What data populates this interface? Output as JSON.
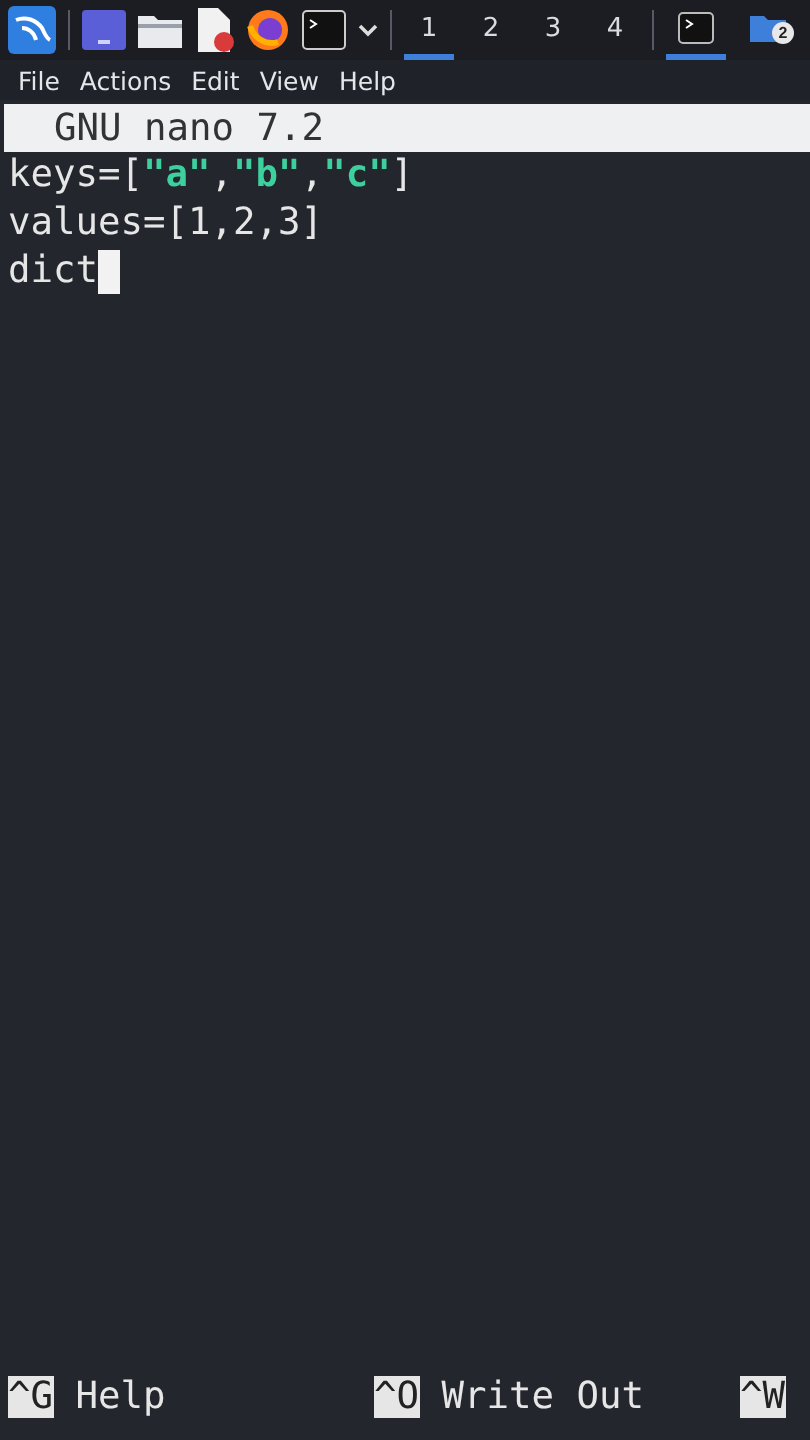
{
  "taskbar": {
    "launchers": [
      {
        "kind": "kali"
      },
      {
        "kind": "desktop"
      },
      {
        "kind": "folder"
      },
      {
        "kind": "editor"
      },
      {
        "kind": "firefox"
      },
      {
        "kind": "terminal"
      },
      {
        "kind": "chevron"
      }
    ],
    "workspaces": [
      {
        "label": "1",
        "selected": true
      },
      {
        "label": "2",
        "selected": false
      },
      {
        "label": "3",
        "selected": false
      },
      {
        "label": "4",
        "selected": false
      }
    ],
    "tasks": [
      {
        "kind": "terminal",
        "selected": true
      },
      {
        "kind": "folder",
        "selected": false,
        "badge": "2"
      }
    ]
  },
  "menu": [
    "File",
    "Actions",
    "Edit",
    "View",
    "Help"
  ],
  "nano": {
    "title": "GNU nano 7.2",
    "lines": [
      {
        "segments": [
          {
            "kind": "plain",
            "text": "keys=["
          },
          {
            "kind": "string",
            "text": "\"a\""
          },
          {
            "kind": "plain",
            "text": ","
          },
          {
            "kind": "string",
            "text": "\"b\""
          },
          {
            "kind": "plain",
            "text": ","
          },
          {
            "kind": "string",
            "text": "\"c\""
          },
          {
            "kind": "plain",
            "text": "]"
          }
        ],
        "cursor": false
      },
      {
        "segments": [
          {
            "kind": "plain",
            "text": "values=[1,2,3]"
          }
        ],
        "cursor": false
      },
      {
        "segments": [
          {
            "kind": "plain",
            "text": "dict"
          }
        ],
        "cursor": true
      }
    ],
    "shortcuts": [
      {
        "key": "^G",
        "label": "Help"
      },
      {
        "key": "^O",
        "label": "Write Out"
      },
      {
        "key": "^W"
      }
    ]
  }
}
